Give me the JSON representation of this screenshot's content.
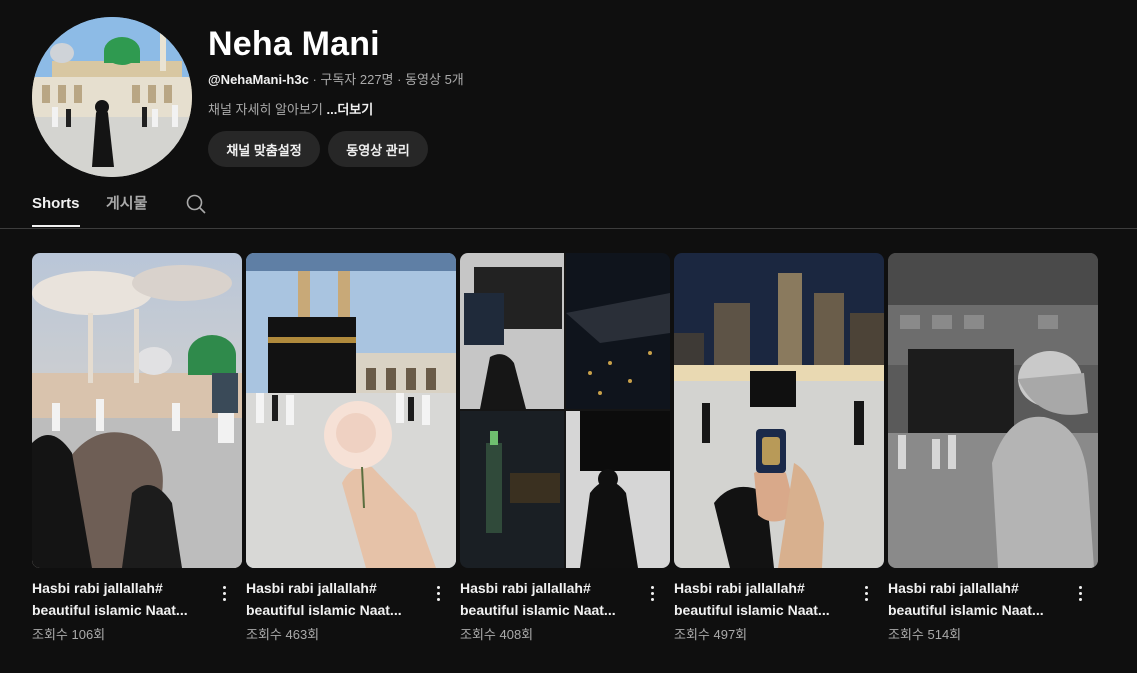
{
  "channel": {
    "name": "Neha Mani",
    "handle": "@NehaMani-h3c",
    "stats": "· 구독자 227명 · 동영상 5개",
    "about": "채널 자세히 알아보기",
    "more_label": "...더보기"
  },
  "actions": {
    "customize_label": "채널 맞춤설정",
    "manage_label": "동영상 관리"
  },
  "tabs": [
    {
      "label": "Shorts",
      "selected": true
    },
    {
      "label": "게시물",
      "selected": false
    }
  ],
  "icons": {
    "search": "search-icon",
    "more": "more-vert-icon"
  },
  "shorts": [
    {
      "title_line1": "Hasbi rabi jallallah#",
      "title_line2": "beautiful islamic Naat...",
      "views": "조회수 106회"
    },
    {
      "title_line1": "Hasbi rabi jallallah#",
      "title_line2": "beautiful islamic Naat...",
      "views": "조회수 463회"
    },
    {
      "title_line1": "Hasbi rabi jallallah#",
      "title_line2": "beautiful islamic Naat...",
      "views": "조회수 408회"
    },
    {
      "title_line1": "Hasbi rabi jallallah#",
      "title_line2": "beautiful islamic Naat...",
      "views": "조회수 497회"
    },
    {
      "title_line1": "Hasbi rabi jallallah#",
      "title_line2": "beautiful islamic Naat...",
      "views": "조회수 514회"
    }
  ],
  "colors": {
    "background": "#0f0f0f",
    "button": "#272727",
    "text": "#f1f1f1",
    "muted": "#aaaaaa",
    "dome": "#2f8a4b"
  }
}
